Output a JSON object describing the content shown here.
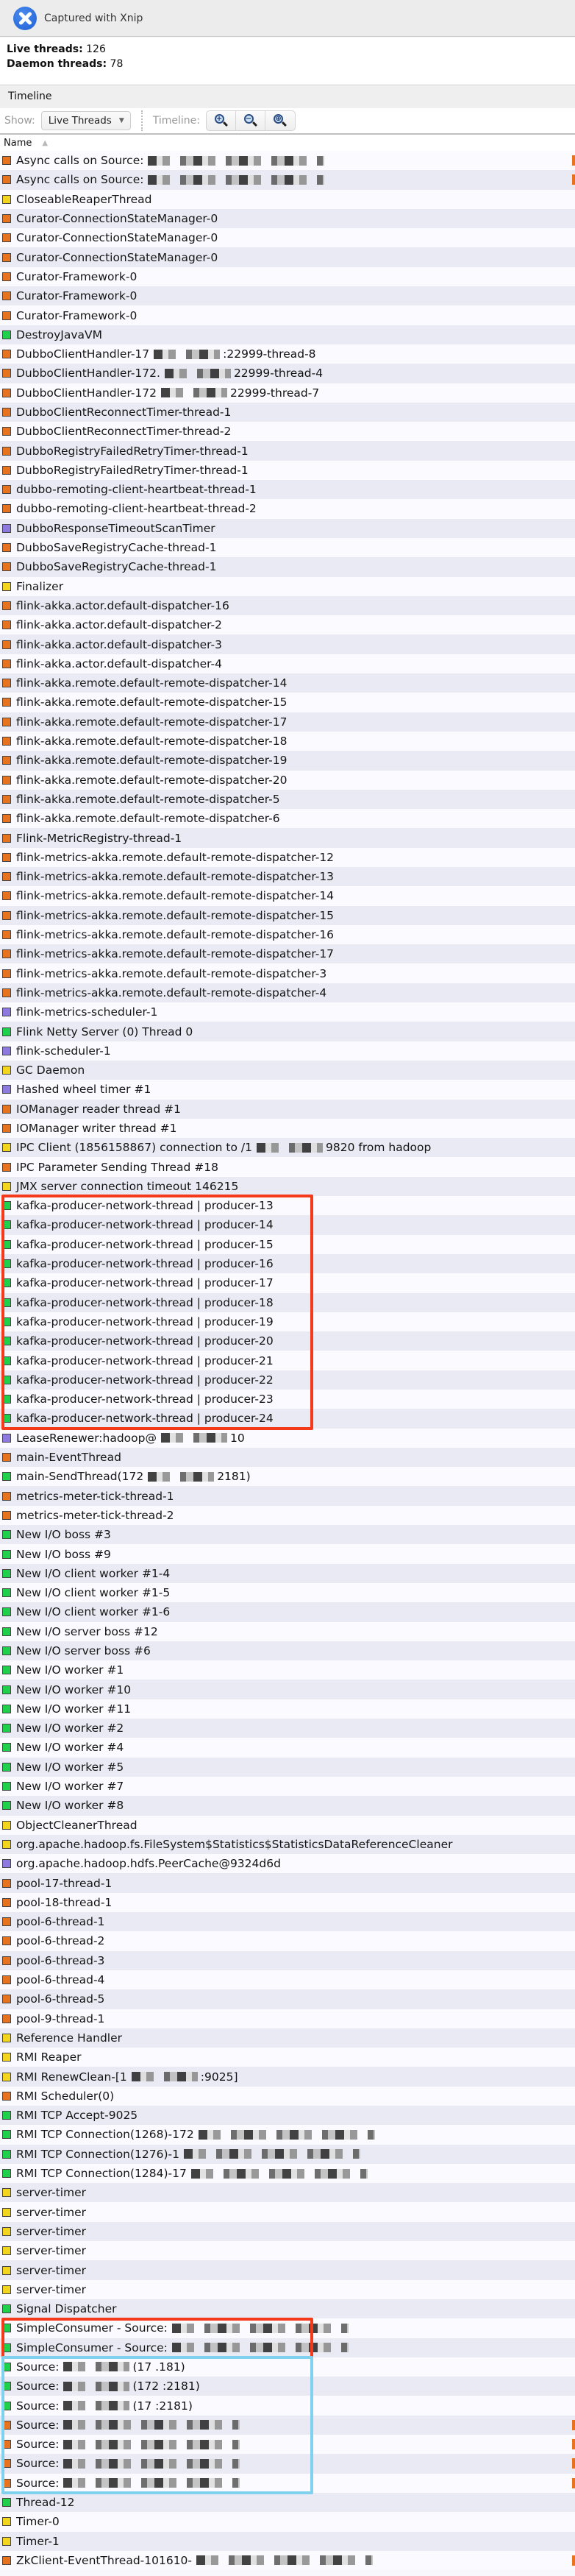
{
  "capture_bar": {
    "text": "Captured with Xnip",
    "logo_icon": "xnip-logo-icon"
  },
  "summary": {
    "live_label": "Live threads:",
    "live_value": "126",
    "daemon_label": "Daemon threads:",
    "daemon_value": "78"
  },
  "timeline_header": {
    "title": "Timeline"
  },
  "toolbar": {
    "show_label": "Show:",
    "show_selected": "Live Threads",
    "timeline_label": "Timeline:",
    "zoom_in_glyph": "+",
    "zoom_out_glyph": "−",
    "zoom_fit_glyph": "⊕"
  },
  "table": {
    "name_column": "Name",
    "sort_indicator": "▲"
  },
  "state_colors": {
    "running": "#1fd14a",
    "sleeping": "#8e79e0",
    "wait": "#f2d51c",
    "park": "#e8731e"
  },
  "threads": [
    {
      "name": "Async calls on Source:",
      "state": "park",
      "redacted": true
    },
    {
      "name": "Async calls on Source:",
      "state": "park",
      "redacted": true
    },
    {
      "name": "CloseableReaperThread",
      "state": "wait"
    },
    {
      "name": "Curator-ConnectionStateManager-0",
      "state": "park"
    },
    {
      "name": "Curator-ConnectionStateManager-0",
      "state": "park"
    },
    {
      "name": "Curator-ConnectionStateManager-0",
      "state": "park"
    },
    {
      "name": "Curator-Framework-0",
      "state": "park"
    },
    {
      "name": "Curator-Framework-0",
      "state": "park"
    },
    {
      "name": "Curator-Framework-0",
      "state": "park"
    },
    {
      "name": "DestroyJavaVM",
      "state": "running"
    },
    {
      "name": "DubboClientHandler-17",
      "state": "park",
      "redacted": true,
      "tail": ":22999-thread-8"
    },
    {
      "name": "DubboClientHandler-172.",
      "state": "park",
      "redacted": true,
      "tail": "22999-thread-4"
    },
    {
      "name": "DubboClientHandler-172",
      "state": "park",
      "redacted": true,
      "tail": "22999-thread-7"
    },
    {
      "name": "DubboClientReconnectTimer-thread-1",
      "state": "park"
    },
    {
      "name": "DubboClientReconnectTimer-thread-2",
      "state": "park"
    },
    {
      "name": "DubboRegistryFailedRetryTimer-thread-1",
      "state": "park"
    },
    {
      "name": "DubboRegistryFailedRetryTimer-thread-1",
      "state": "park"
    },
    {
      "name": "dubbo-remoting-client-heartbeat-thread-1",
      "state": "park"
    },
    {
      "name": "dubbo-remoting-client-heartbeat-thread-2",
      "state": "park"
    },
    {
      "name": "DubboResponseTimeoutScanTimer",
      "state": "sleeping"
    },
    {
      "name": "DubboSaveRegistryCache-thread-1",
      "state": "park"
    },
    {
      "name": "DubboSaveRegistryCache-thread-1",
      "state": "park"
    },
    {
      "name": "Finalizer",
      "state": "wait"
    },
    {
      "name": "flink-akka.actor.default-dispatcher-16",
      "state": "park"
    },
    {
      "name": "flink-akka.actor.default-dispatcher-2",
      "state": "park"
    },
    {
      "name": "flink-akka.actor.default-dispatcher-3",
      "state": "park"
    },
    {
      "name": "flink-akka.actor.default-dispatcher-4",
      "state": "park"
    },
    {
      "name": "flink-akka.remote.default-remote-dispatcher-14",
      "state": "park"
    },
    {
      "name": "flink-akka.remote.default-remote-dispatcher-15",
      "state": "park"
    },
    {
      "name": "flink-akka.remote.default-remote-dispatcher-17",
      "state": "park"
    },
    {
      "name": "flink-akka.remote.default-remote-dispatcher-18",
      "state": "park"
    },
    {
      "name": "flink-akka.remote.default-remote-dispatcher-19",
      "state": "park"
    },
    {
      "name": "flink-akka.remote.default-remote-dispatcher-20",
      "state": "park"
    },
    {
      "name": "flink-akka.remote.default-remote-dispatcher-5",
      "state": "park"
    },
    {
      "name": "flink-akka.remote.default-remote-dispatcher-6",
      "state": "park"
    },
    {
      "name": "Flink-MetricRegistry-thread-1",
      "state": "park"
    },
    {
      "name": "flink-metrics-akka.remote.default-remote-dispatcher-12",
      "state": "park"
    },
    {
      "name": "flink-metrics-akka.remote.default-remote-dispatcher-13",
      "state": "park"
    },
    {
      "name": "flink-metrics-akka.remote.default-remote-dispatcher-14",
      "state": "park"
    },
    {
      "name": "flink-metrics-akka.remote.default-remote-dispatcher-15",
      "state": "park"
    },
    {
      "name": "flink-metrics-akka.remote.default-remote-dispatcher-16",
      "state": "park"
    },
    {
      "name": "flink-metrics-akka.remote.default-remote-dispatcher-17",
      "state": "park"
    },
    {
      "name": "flink-metrics-akka.remote.default-remote-dispatcher-3",
      "state": "park"
    },
    {
      "name": "flink-metrics-akka.remote.default-remote-dispatcher-4",
      "state": "park"
    },
    {
      "name": "flink-metrics-scheduler-1",
      "state": "sleeping"
    },
    {
      "name": "Flink Netty Server (0) Thread 0",
      "state": "running"
    },
    {
      "name": "flink-scheduler-1",
      "state": "sleeping"
    },
    {
      "name": "GC Daemon",
      "state": "wait"
    },
    {
      "name": "Hashed wheel timer #1",
      "state": "sleeping"
    },
    {
      "name": "IOManager reader thread #1",
      "state": "park"
    },
    {
      "name": "IOManager writer thread #1",
      "state": "park"
    },
    {
      "name": "IPC Client (1856158867) connection to /1",
      "state": "wait",
      "redacted": true,
      "tail": "9820 from hadoop"
    },
    {
      "name": "IPC Parameter Sending Thread #18",
      "state": "park"
    },
    {
      "name": "JMX server connection timeout 146215",
      "state": "wait"
    },
    {
      "name": "kafka-producer-network-thread | producer-13",
      "state": "running"
    },
    {
      "name": "kafka-producer-network-thread | producer-14",
      "state": "running"
    },
    {
      "name": "kafka-producer-network-thread | producer-15",
      "state": "running"
    },
    {
      "name": "kafka-producer-network-thread | producer-16",
      "state": "running"
    },
    {
      "name": "kafka-producer-network-thread | producer-17",
      "state": "running"
    },
    {
      "name": "kafka-producer-network-thread | producer-18",
      "state": "running"
    },
    {
      "name": "kafka-producer-network-thread | producer-19",
      "state": "running"
    },
    {
      "name": "kafka-producer-network-thread | producer-20",
      "state": "running"
    },
    {
      "name": "kafka-producer-network-thread | producer-21",
      "state": "running"
    },
    {
      "name": "kafka-producer-network-thread | producer-22",
      "state": "running"
    },
    {
      "name": "kafka-producer-network-thread | producer-23",
      "state": "running"
    },
    {
      "name": "kafka-producer-network-thread | producer-24",
      "state": "running"
    },
    {
      "name": "LeaseRenewer:hadoop@",
      "state": "sleeping",
      "redacted": true,
      "tail": "10"
    },
    {
      "name": "main-EventThread",
      "state": "park"
    },
    {
      "name": "main-SendThread(172",
      "state": "running",
      "redacted": true,
      "tail": "2181)"
    },
    {
      "name": "metrics-meter-tick-thread-1",
      "state": "park"
    },
    {
      "name": "metrics-meter-tick-thread-2",
      "state": "park"
    },
    {
      "name": "New I/O boss #3",
      "state": "running"
    },
    {
      "name": "New I/O boss #9",
      "state": "running"
    },
    {
      "name": "New I/O client worker #1-4",
      "state": "running"
    },
    {
      "name": "New I/O client worker #1-5",
      "state": "running"
    },
    {
      "name": "New I/O client worker #1-6",
      "state": "running"
    },
    {
      "name": "New I/O server boss #12",
      "state": "running"
    },
    {
      "name": "New I/O server boss #6",
      "state": "running"
    },
    {
      "name": "New I/O worker #1",
      "state": "running"
    },
    {
      "name": "New I/O worker #10",
      "state": "running"
    },
    {
      "name": "New I/O worker #11",
      "state": "running"
    },
    {
      "name": "New I/O worker #2",
      "state": "running"
    },
    {
      "name": "New I/O worker #4",
      "state": "running"
    },
    {
      "name": "New I/O worker #5",
      "state": "running"
    },
    {
      "name": "New I/O worker #7",
      "state": "running"
    },
    {
      "name": "New I/O worker #8",
      "state": "running"
    },
    {
      "name": "ObjectCleanerThread",
      "state": "wait"
    },
    {
      "name": "org.apache.hadoop.fs.FileSystem$Statistics$StatisticsDataReferenceCleaner",
      "state": "wait"
    },
    {
      "name": "org.apache.hadoop.hdfs.PeerCache@9324d6d",
      "state": "sleeping"
    },
    {
      "name": "pool-17-thread-1",
      "state": "park"
    },
    {
      "name": "pool-18-thread-1",
      "state": "park"
    },
    {
      "name": "pool-6-thread-1",
      "state": "park"
    },
    {
      "name": "pool-6-thread-2",
      "state": "park"
    },
    {
      "name": "pool-6-thread-3",
      "state": "park"
    },
    {
      "name": "pool-6-thread-4",
      "state": "park"
    },
    {
      "name": "pool-6-thread-5",
      "state": "park"
    },
    {
      "name": "pool-9-thread-1",
      "state": "park"
    },
    {
      "name": "Reference Handler",
      "state": "wait"
    },
    {
      "name": "RMI Reaper",
      "state": "wait"
    },
    {
      "name": "RMI RenewClean-[1",
      "state": "wait",
      "redacted": true,
      "tail": ":9025]"
    },
    {
      "name": "RMI Scheduler(0)",
      "state": "park"
    },
    {
      "name": "RMI TCP Accept-9025",
      "state": "running"
    },
    {
      "name": "RMI TCP Connection(1268)-172",
      "state": "running",
      "redacted": true
    },
    {
      "name": "RMI TCP Connection(1276)-1",
      "state": "running",
      "redacted": true
    },
    {
      "name": "RMI TCP Connection(1284)-17",
      "state": "running",
      "redacted": true
    },
    {
      "name": "server-timer",
      "state": "wait"
    },
    {
      "name": "server-timer",
      "state": "wait"
    },
    {
      "name": "server-timer",
      "state": "wait"
    },
    {
      "name": "server-timer",
      "state": "wait"
    },
    {
      "name": "server-timer",
      "state": "wait"
    },
    {
      "name": "server-timer",
      "state": "wait"
    },
    {
      "name": "Signal Dispatcher",
      "state": "running"
    },
    {
      "name": "SimpleConsumer - Source:",
      "state": "running",
      "redacted": true
    },
    {
      "name": "SimpleConsumer - Source:",
      "state": "running",
      "redacted": true
    },
    {
      "name": "Source:",
      "state": "running",
      "redacted": true,
      "tail": "(17 .181)"
    },
    {
      "name": "Source:",
      "state": "running",
      "redacted": true,
      "tail": "(172 :2181)"
    },
    {
      "name": "Source:",
      "state": "running",
      "redacted": true,
      "tail": "(17 :2181)"
    },
    {
      "name": "Source:",
      "state": "park",
      "redacted": true
    },
    {
      "name": "Source:",
      "state": "park",
      "redacted": true
    },
    {
      "name": "Source:",
      "state": "park",
      "redacted": true
    },
    {
      "name": "Source:",
      "state": "park",
      "redacted": true
    },
    {
      "name": "Thread-12",
      "state": "running"
    },
    {
      "name": "Timer-0",
      "state": "wait"
    },
    {
      "name": "Timer-1",
      "state": "wait"
    },
    {
      "name": "ZkClient-EventThread-101610-",
      "state": "park",
      "redacted": true
    }
  ],
  "annotations": [
    {
      "color": "red",
      "label": "kafka-producer-highlight",
      "first_row": 54,
      "last_row": 65
    },
    {
      "color": "red",
      "label": "simple-consumer-highlight",
      "first_row": 112,
      "last_row": 113
    },
    {
      "color": "blue",
      "label": "source-highlight",
      "first_row": 114,
      "last_row": 120
    }
  ]
}
